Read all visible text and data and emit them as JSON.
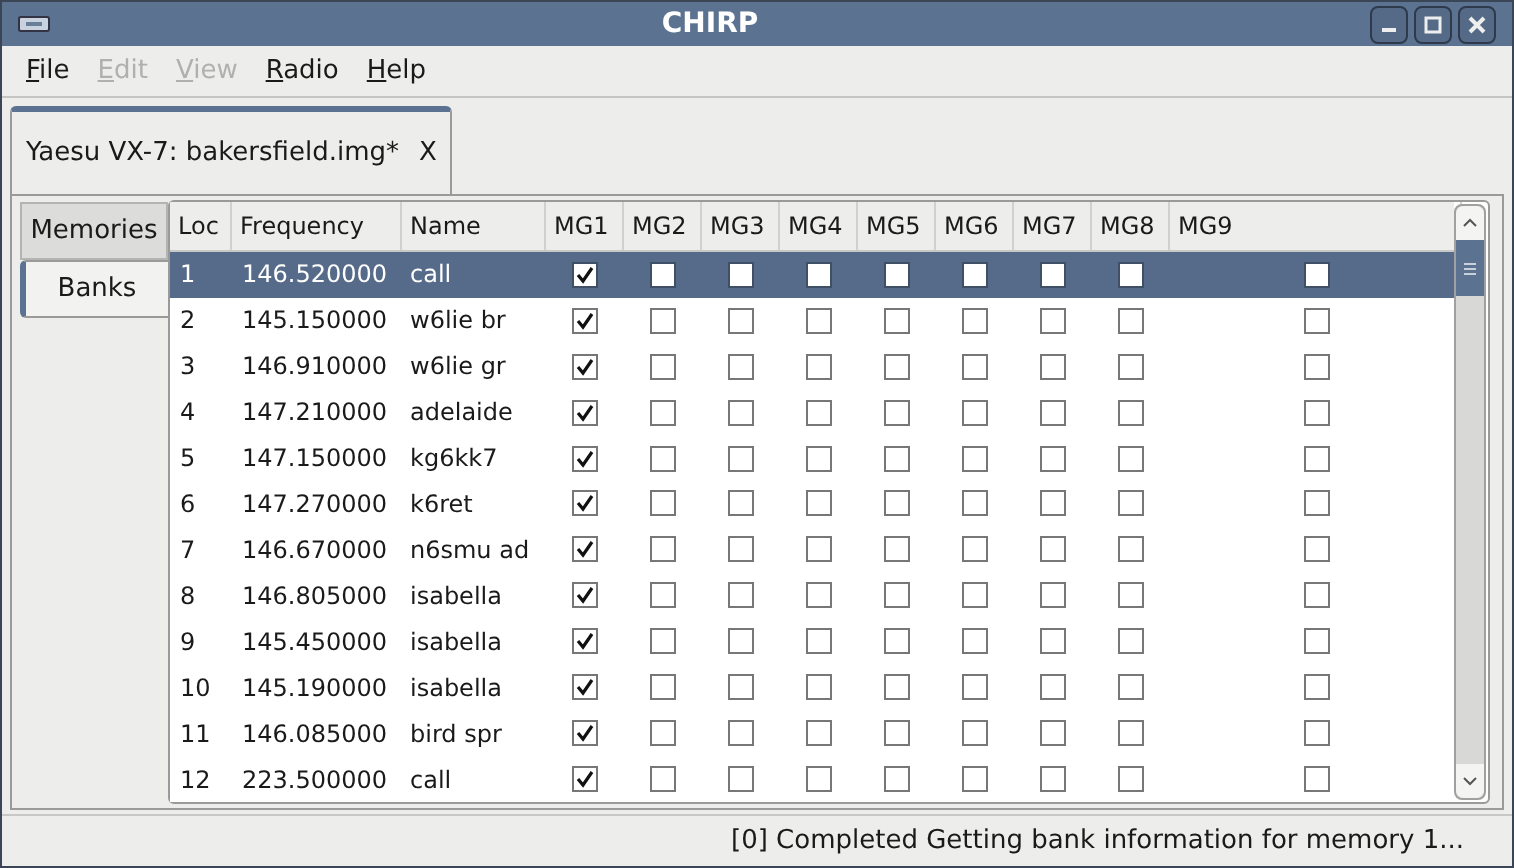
{
  "window": {
    "title": "CHIRP"
  },
  "menu": [
    {
      "label": "File",
      "disabled": false
    },
    {
      "label": "Edit",
      "disabled": true
    },
    {
      "label": "View",
      "disabled": true
    },
    {
      "label": "Radio",
      "disabled": false
    },
    {
      "label": "Help",
      "disabled": false
    }
  ],
  "document_tab": {
    "label": "Yaesu VX-7: bakersfield.img*",
    "close": "X"
  },
  "side_tabs": [
    {
      "label": "Memories",
      "selected": false
    },
    {
      "label": "Banks",
      "selected": true
    }
  ],
  "table": {
    "columns": [
      "Loc",
      "Frequency",
      "Name",
      "MG1",
      "MG2",
      "MG3",
      "MG4",
      "MG5",
      "MG6",
      "MG7",
      "MG8",
      "MG9"
    ],
    "rows": [
      {
        "loc": "1",
        "frequency": "146.520000",
        "name": "call",
        "selected": true,
        "banks": [
          true,
          false,
          false,
          false,
          false,
          false,
          false,
          false,
          false
        ]
      },
      {
        "loc": "2",
        "frequency": "145.150000",
        "name": "w6lie br",
        "selected": false,
        "banks": [
          true,
          false,
          false,
          false,
          false,
          false,
          false,
          false,
          false
        ]
      },
      {
        "loc": "3",
        "frequency": "146.910000",
        "name": "w6lie gr",
        "selected": false,
        "banks": [
          true,
          false,
          false,
          false,
          false,
          false,
          false,
          false,
          false
        ]
      },
      {
        "loc": "4",
        "frequency": "147.210000",
        "name": "adelaide",
        "selected": false,
        "banks": [
          true,
          false,
          false,
          false,
          false,
          false,
          false,
          false,
          false
        ]
      },
      {
        "loc": "5",
        "frequency": "147.150000",
        "name": "kg6kk7",
        "selected": false,
        "banks": [
          true,
          false,
          false,
          false,
          false,
          false,
          false,
          false,
          false
        ]
      },
      {
        "loc": "6",
        "frequency": "147.270000",
        "name": "k6ret",
        "selected": false,
        "banks": [
          true,
          false,
          false,
          false,
          false,
          false,
          false,
          false,
          false
        ]
      },
      {
        "loc": "7",
        "frequency": "146.670000",
        "name": "n6smu ad",
        "selected": false,
        "banks": [
          true,
          false,
          false,
          false,
          false,
          false,
          false,
          false,
          false
        ]
      },
      {
        "loc": "8",
        "frequency": "146.805000",
        "name": "isabella",
        "selected": false,
        "banks": [
          true,
          false,
          false,
          false,
          false,
          false,
          false,
          false,
          false
        ]
      },
      {
        "loc": "9",
        "frequency": "145.450000",
        "name": "isabella",
        "selected": false,
        "banks": [
          true,
          false,
          false,
          false,
          false,
          false,
          false,
          false,
          false
        ]
      },
      {
        "loc": "10",
        "frequency": "145.190000",
        "name": "isabella",
        "selected": false,
        "banks": [
          true,
          false,
          false,
          false,
          false,
          false,
          false,
          false,
          false
        ]
      },
      {
        "loc": "11",
        "frequency": "146.085000",
        "name": "bird spr",
        "selected": false,
        "banks": [
          true,
          false,
          false,
          false,
          false,
          false,
          false,
          false,
          false
        ]
      },
      {
        "loc": "12",
        "frequency": "223.500000",
        "name": "call",
        "selected": false,
        "banks": [
          true,
          false,
          false,
          false,
          false,
          false,
          false,
          false,
          false
        ]
      }
    ]
  },
  "status_bar": "[0] Completed Getting bank information for memory 1..."
}
